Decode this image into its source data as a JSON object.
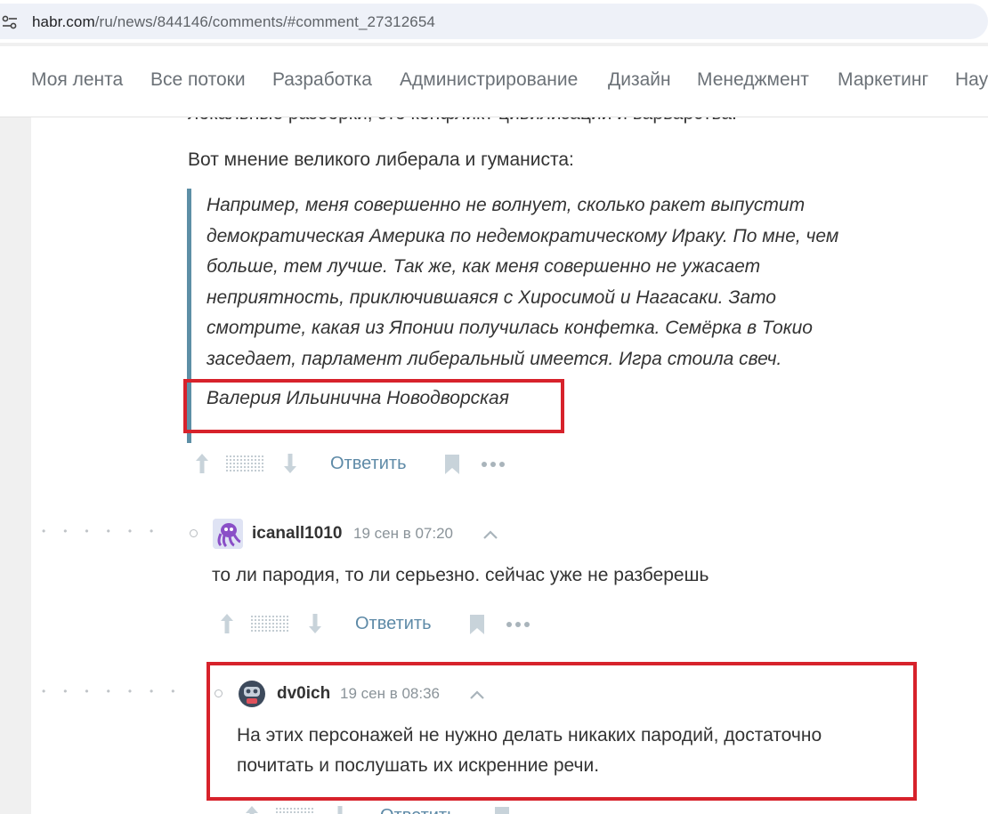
{
  "browser": {
    "url_host": "habr.com",
    "url_path": "/ru/news/844146/comments/#comment_27312654"
  },
  "nav": {
    "items": [
      "Моя лента",
      "Все потоки",
      "Разработка",
      "Администрирование",
      "Дизайн",
      "Менеджмент",
      "Маркетинг",
      "Нау"
    ]
  },
  "article_comment": {
    "clipped_text": "локальные разборки, это конфликт цивилизации и варварства.",
    "intro": "Вот мнение великого либерала и гуманиста:",
    "quote_lines": [
      "Например, меня совершенно не волнует, сколько ракет выпустит",
      "демократическая Америка по недемократическому Ираку. По мне, чем",
      "больше, тем лучше. Так же, как меня совершенно не ужасает",
      "неприятность, приключившаяся с Хиросимой и Нагасаки. Зато",
      "смотрите, какая из Японии получилась конфетка. Семёрка в Токио",
      "заседает, парламент либеральный имеется. Игра стоила свеч."
    ],
    "quote_author": "Валерия Ильинична Новодворская",
    "reply_label": "Ответить"
  },
  "comments": [
    {
      "username": "icanall1010",
      "timestamp": "19 сен в 07:20",
      "text_lines": [
        "то ли пародия, то ли серьезно. сейчас уже не разберешь"
      ],
      "reply_label": "Ответить"
    },
    {
      "username": "dv0ich",
      "timestamp": "19 сен в 08:36",
      "text_lines": [
        "На этих персонажей не нужно делать никаких пародий, достаточно",
        "почитать и послушать их искренние речи."
      ],
      "reply_label": "Ответить"
    }
  ],
  "colors": {
    "accent_link": "#5e8aa7",
    "highlight_red": "#d7222b",
    "quote_bar": "#5d8fa6"
  }
}
